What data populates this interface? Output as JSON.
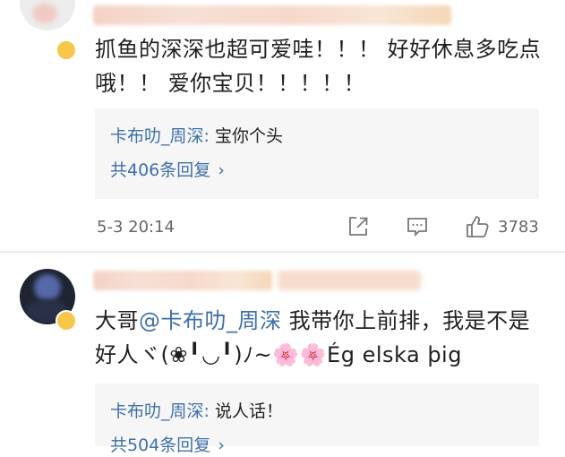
{
  "comments": [
    {
      "text": "抓鱼的深深也超可爱哇！！！ 好好休息多吃点哦！！ 爱你宝贝！！！！！",
      "reply": {
        "user": "卡布叻_周深",
        "sep": ": ",
        "text": "宝你个头",
        "count_label": "共406条回复",
        "chevron": "›"
      },
      "time": "5-3 20:14",
      "actions": {
        "share_icon": "share-icon",
        "comment_icon": "comment-icon",
        "like_icon": "thumbs-up-icon",
        "like_count": "3783"
      }
    },
    {
      "text_before": "大哥",
      "mention": "@卡布叻_周深",
      "text_after": " 我带你上前排，我是不是好人ヾ(❀╹◡╹)ﾉ~🌸🌸Ég elska þig",
      "reply": {
        "user": "卡布叻_周深",
        "sep": ": ",
        "text": "说人话！",
        "count_label": "共504条回复",
        "chevron": "›"
      }
    }
  ],
  "colors": {
    "link": "#3f70a8",
    "reply_bg": "#f6f6f6",
    "meta": "#666666"
  }
}
